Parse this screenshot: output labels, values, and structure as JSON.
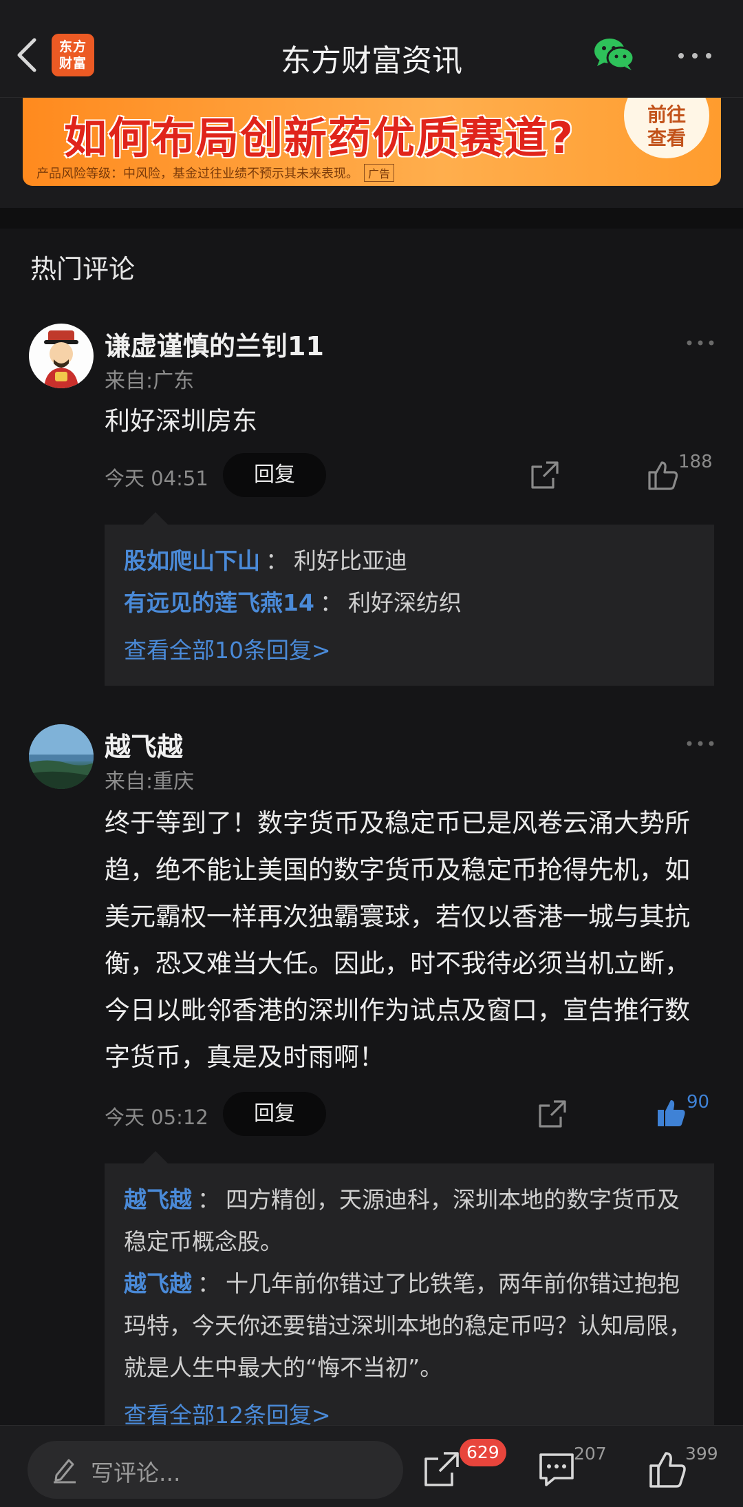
{
  "header": {
    "title": "东方财富资讯",
    "logo_text_top": "东方",
    "logo_text_bottom": "财富"
  },
  "ad": {
    "headline": "如何布局创新药优质赛道?",
    "cta_line1": "前往",
    "cta_line2": "查看",
    "disclaimer": "产品风险等级：中风险，基金过往业绩不预示其未来表现。",
    "tag": "广告"
  },
  "section_title": "热门评论",
  "comments": [
    {
      "username": "谦虚谨慎的兰钊11",
      "location": "来自:广东",
      "text": "利好深圳房东",
      "time": "今天 04:51",
      "reply_label": "回复",
      "likes": "188",
      "replies": [
        {
          "user": "股如爬山下山",
          "sep": "：",
          "text": "利好比亚迪"
        },
        {
          "user": "有远见的莲飞燕14",
          "sep": "：",
          "text": "利好深纺织"
        }
      ],
      "view_all": "查看全部10条回复>"
    },
    {
      "username": "越飞越",
      "location": "来自:重庆",
      "text": "终于等到了！数字货币及稳定币已是风卷云涌大势所趋，绝不能让美国的数字货币及稳定币抢得先机，如美元霸权一样再次独霸寰球，若仅以香港一城与其抗衡，恐又难当大任。因此，时不我待必须当机立断，今日以毗邻香港的深圳作为试点及窗口，宣告推行数字货币，真是及时雨啊！",
      "time": "今天 05:12",
      "reply_label": "回复",
      "likes": "90",
      "replies": [
        {
          "user": "越飞越",
          "sep": "：",
          "text": "四方精创，天源迪科，深圳本地的数字货币及稳定币概念股。"
        },
        {
          "user": "越飞越",
          "sep": "：",
          "text": "十几年前你错过了比铁笔，两年前你错过抱抱玛特，今天你还要错过深圳本地的稳定币吗？认知局限，就是人生中最大的“悔不当初”。"
        }
      ],
      "view_all": "查看全部12条回复>"
    }
  ],
  "bottom_bar": {
    "placeholder": "写评论...",
    "share_badge": "629",
    "comment_count": "207",
    "like_count": "399"
  },
  "colors": {
    "accent_blue": "#4a8ad8",
    "badge_red": "#e8453c",
    "logo_orange": "#ec5a24"
  }
}
